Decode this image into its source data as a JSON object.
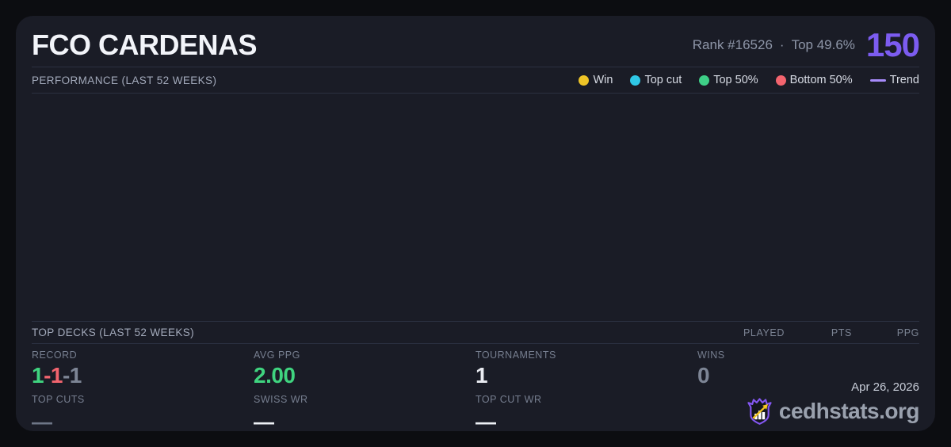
{
  "header": {
    "title": "FCO CARDENAS",
    "rank": "Rank #16526",
    "separator": "·",
    "top_percent": "Top 49.6%",
    "elo": "150"
  },
  "performance": {
    "section_label": "PERFORMANCE (LAST 52 WEEKS)",
    "legend": [
      {
        "label": "Win",
        "color": "#eec427",
        "type": "dot"
      },
      {
        "label": "Top cut",
        "color": "#2fc8e6",
        "type": "dot"
      },
      {
        "label": "Top 50%",
        "color": "#3ecf87",
        "type": "dot"
      },
      {
        "label": "Bottom 50%",
        "color": "#f3646e",
        "type": "dot"
      },
      {
        "label": "Trend",
        "color": "#a78bfa",
        "type": "line"
      }
    ]
  },
  "top_decks": {
    "section_label": "TOP DECKS (LAST 52 WEEKS)",
    "columns": [
      "PLAYED",
      "PTS",
      "PPG"
    ]
  },
  "stats": {
    "record": {
      "label": "RECORD",
      "segments": [
        {
          "text": "1",
          "meaning": "wins"
        },
        {
          "text": "-1",
          "meaning": "losses"
        },
        {
          "text": "-1",
          "meaning": "draws"
        }
      ]
    },
    "avg_ppg": {
      "label": "AVG PPG",
      "value": "2.00"
    },
    "tournaments": {
      "label": "TOURNAMENTS",
      "value": "1"
    },
    "wins": {
      "label": "WINS",
      "value": "0"
    },
    "top_cuts": {
      "label": "TOP CUTS",
      "value": "—"
    },
    "swiss_wr": {
      "label": "SWISS WR",
      "value": "—"
    },
    "top_cut_wr": {
      "label": "TOP CUT WR",
      "value": "—"
    }
  },
  "footer": {
    "date": "Apr 26, 2026",
    "brand": "cedhstats.org",
    "logo_icon": "crown-shield-chart-logo"
  },
  "colors": {
    "page_background": "#0c0d11",
    "card_background": "#1a1c26",
    "divider": "#2b3040",
    "accent_purple": "#7c5cf0",
    "win_gold": "#eec427",
    "top_cut_cyan": "#2fc8e6",
    "top50_green": "#3ecf87",
    "bottom50_red": "#f3646e",
    "trend_purple": "#a78bfa",
    "value_green": "#3fd47f",
    "value_red": "#f2646e",
    "value_gray": "#7d8595",
    "value_white": "#e9ebf1",
    "logo_arrow_gold": "#f5c71e"
  }
}
